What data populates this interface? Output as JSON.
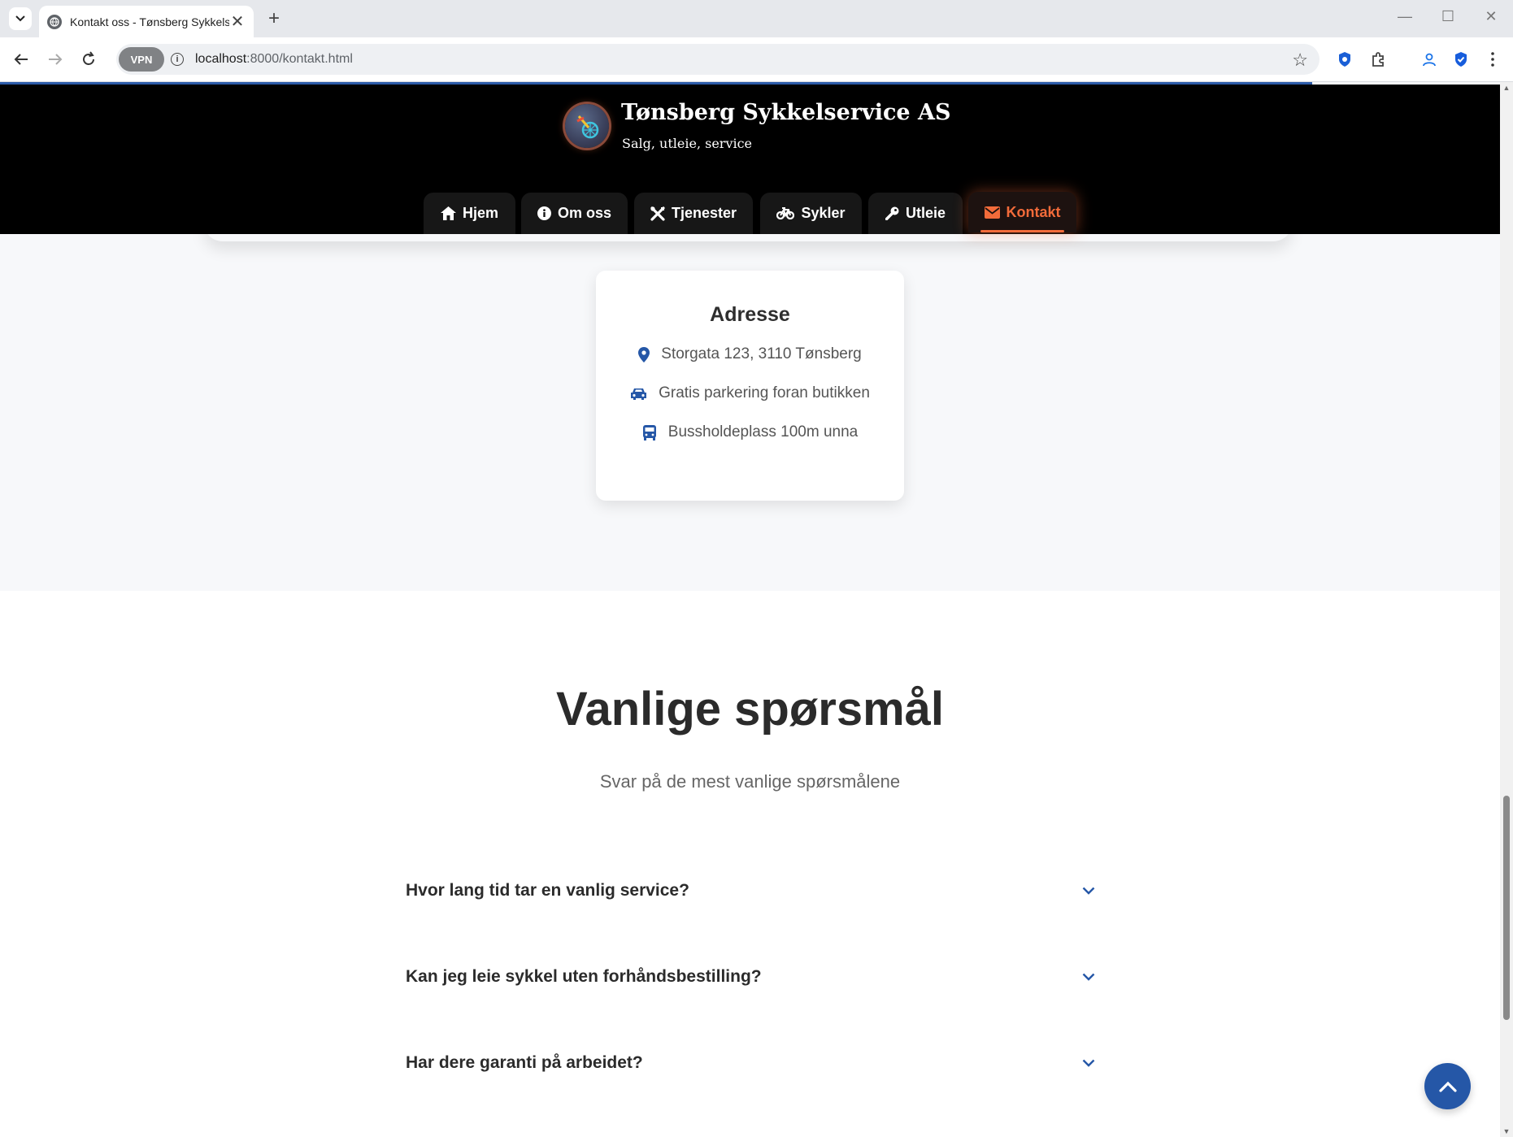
{
  "browser": {
    "tab_title": "Kontakt oss - Tønsberg Sykkelservice AS",
    "url_host": "localhost",
    "url_path": ":8000/kontakt.html",
    "vpn_label": "VPN"
  },
  "site": {
    "title": "Tønsberg Sykkelservice AS",
    "tagline": "Salg, utleie, service",
    "accent_color": "#f26b3a",
    "primary_color": "#2557a7"
  },
  "nav": {
    "items": [
      {
        "label": "Hjem",
        "icon": "home-icon"
      },
      {
        "label": "Om oss",
        "icon": "info-icon"
      },
      {
        "label": "Tjenester",
        "icon": "tools-icon"
      },
      {
        "label": "Sykler",
        "icon": "bicycle-icon"
      },
      {
        "label": "Utleie",
        "icon": "key-icon"
      },
      {
        "label": "Kontakt",
        "icon": "envelope-icon",
        "active": true
      }
    ]
  },
  "address_card": {
    "title": "Adresse",
    "rows": [
      {
        "icon": "map-pin-icon",
        "text": "Storgata 123, 3110 Tønsberg"
      },
      {
        "icon": "car-icon",
        "text": "Gratis parkering foran butikken"
      },
      {
        "icon": "bus-icon",
        "text": "Bussholdeplass 100m unna"
      }
    ]
  },
  "faq": {
    "title": "Vanlige spørsmål",
    "subtitle": "Svar på de mest vanlige spørsmålene",
    "questions": [
      "Hvor lang tid tar en vanlig service?",
      "Kan jeg leie sykkel uten forhåndsbestilling?",
      "Har dere garanti på arbeidet?"
    ]
  }
}
